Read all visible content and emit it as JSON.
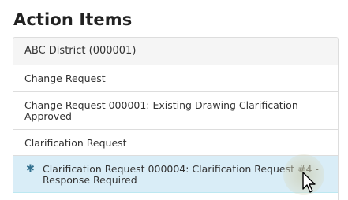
{
  "page": {
    "title": "Action Items"
  },
  "action_items": {
    "header": "ABC District (000001)",
    "rows": [
      {
        "type": "group",
        "label": "Change Request"
      },
      {
        "type": "item",
        "label": "Change Request 000001: Existing Drawing Clarification - Approved"
      },
      {
        "type": "group",
        "label": "Clarification Request"
      },
      {
        "type": "item",
        "label": "Clarification Request 000004: Clarification Request #4 - Response Required",
        "icon": "asterisk-icon",
        "highlighted": true
      }
    ]
  },
  "colors": {
    "highlight_background": "#d9edf7",
    "highlight_icon": "#31708f",
    "header_background": "#f5f5f5",
    "border": "#dddddd"
  },
  "icons": {
    "required_marker": "✱",
    "pointer": "mouse-cursor-icon"
  }
}
